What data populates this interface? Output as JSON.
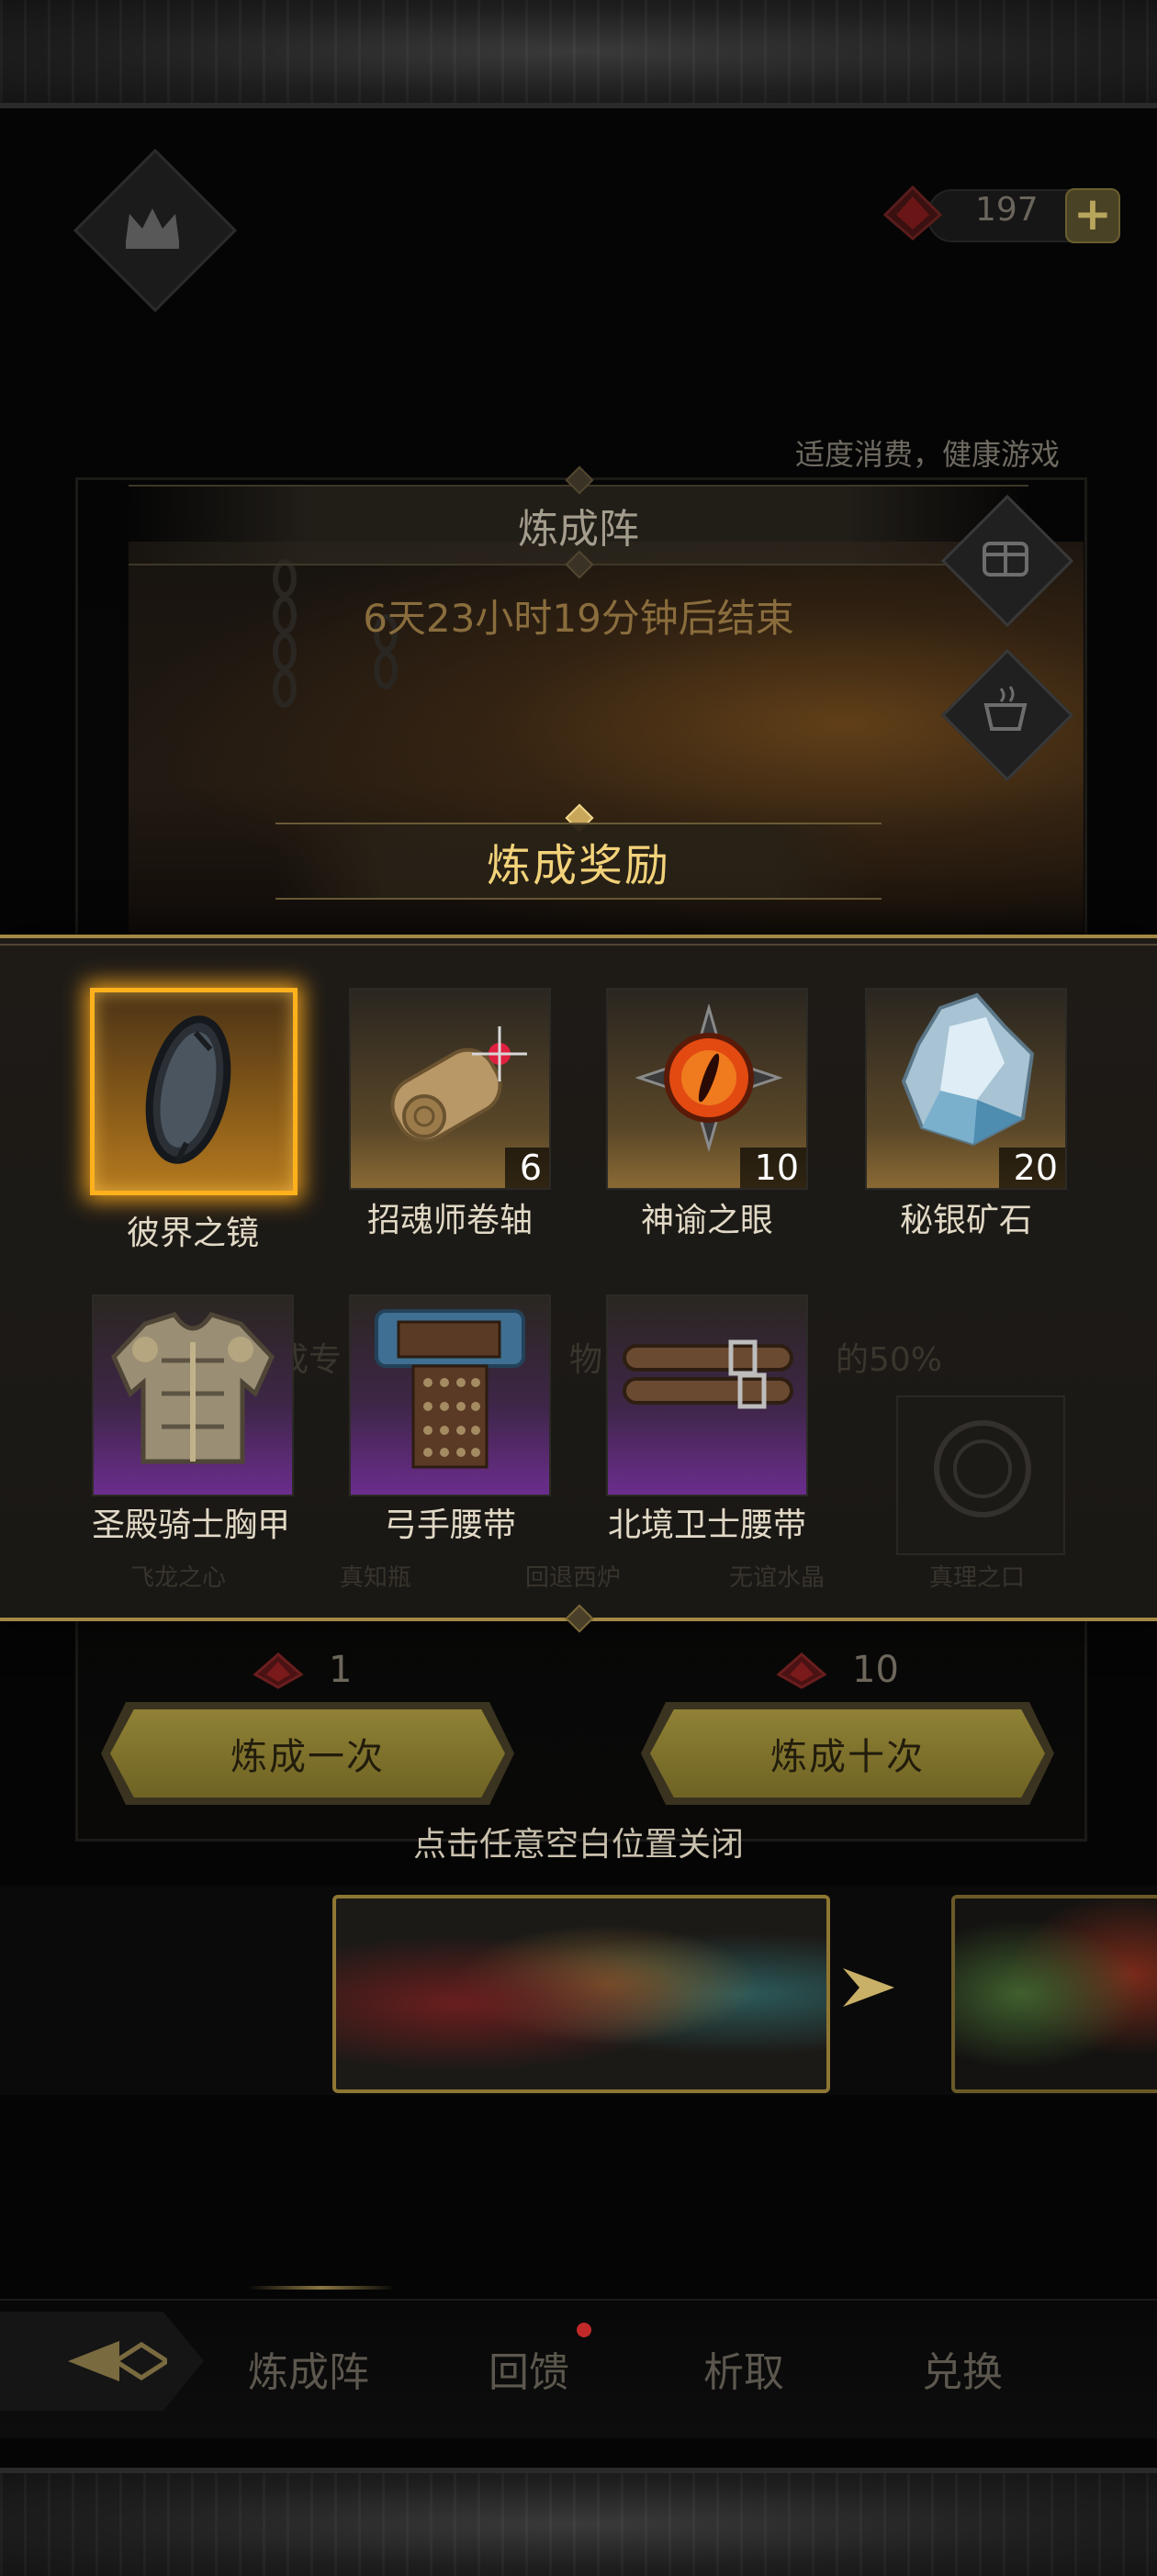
{
  "header": {
    "currency_amount": "197",
    "health_notice": "适度消费，健康游戏"
  },
  "event": {
    "title": "炼成阵",
    "timer": "6天23小时19分钟后结束"
  },
  "rewards": {
    "title": "炼成奖励",
    "items": [
      {
        "name": "彼界之镜",
        "count": "",
        "rarity": "legendary",
        "icon": "mirror-icon"
      },
      {
        "name": "招魂师卷轴",
        "count": "6",
        "rarity": "rare",
        "icon": "scroll-icon"
      },
      {
        "name": "神谕之眼",
        "count": "10",
        "rarity": "rare",
        "icon": "eye-icon"
      },
      {
        "name": "秘银矿石",
        "count": "20",
        "rarity": "rare",
        "icon": "ore-icon"
      },
      {
        "name": "圣殿骑士胸甲",
        "count": "",
        "rarity": "epic",
        "icon": "chestplate-icon"
      },
      {
        "name": "弓手腰带",
        "count": "",
        "rarity": "epic",
        "icon": "belt-icon"
      },
      {
        "name": "北境卫士腰带",
        "count": "",
        "rarity": "epic",
        "icon": "double-belt-icon"
      }
    ]
  },
  "background_text": {
    "promo_fragment_1": "成专",
    "promo_fragment_2": "物",
    "promo_fragment_3": "的50%",
    "slot_labels": [
      "飞龙之心",
      "真知瓶",
      "回退西炉",
      "无谊水晶",
      "真理之口"
    ]
  },
  "actions": {
    "once_cost": "1",
    "once_label": "炼成一次",
    "ten_cost": "10",
    "ten_label": "炼成十次"
  },
  "close_hint": "点击任意空白位置关闭",
  "nav": {
    "tabs": [
      "炼成阵",
      "回馈",
      "析取",
      "兑换"
    ],
    "active_tab": "炼成阵",
    "badge_on": "回馈"
  },
  "colors": {
    "gold_accent": "#f2d27a",
    "legendary_glow": "#ffb11c",
    "epic_purple": "#6b2d8d",
    "button_gold": "#8f8135",
    "badge_red": "#c22a2a"
  }
}
